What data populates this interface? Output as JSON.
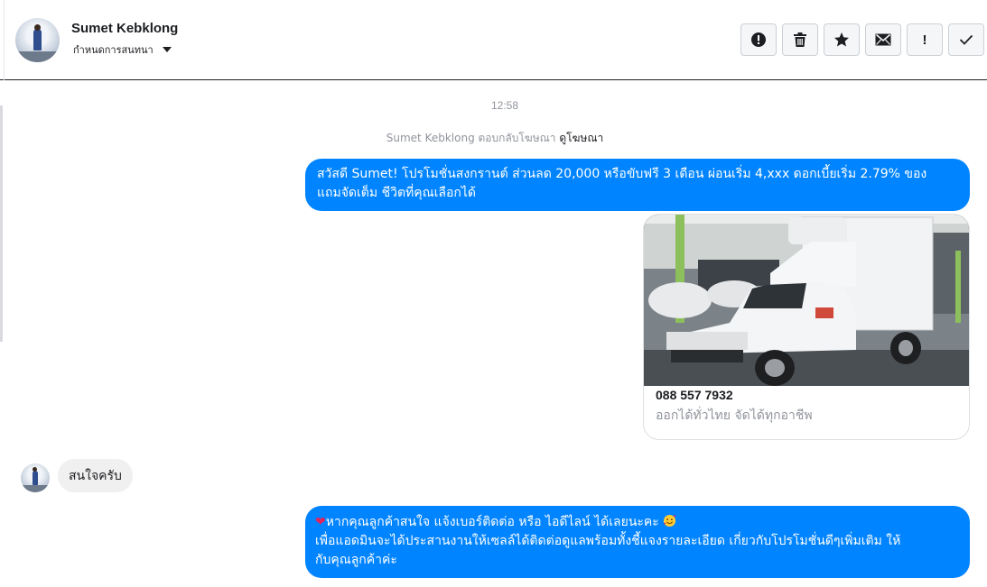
{
  "header": {
    "contact_name": "Sumet Kebklong",
    "subtitle": "กำหนดการสนทนา",
    "actions": [
      {
        "name": "report-button",
        "icon": "alert-circle-icon"
      },
      {
        "name": "delete-button",
        "icon": "trash-icon"
      },
      {
        "name": "star-button",
        "icon": "star-icon"
      },
      {
        "name": "mark-unread-button",
        "icon": "envelope-icon"
      },
      {
        "name": "important-button",
        "icon": "exclamation-icon",
        "label": "!"
      },
      {
        "name": "done-button",
        "icon": "check-icon"
      }
    ]
  },
  "conversation": {
    "timestamp": "12:58",
    "ad_reply": {
      "text": "Sumet Kebklong ตอบกลับโฆษณา",
      "link": "ดูโฆษณา"
    },
    "messages": [
      {
        "direction": "outgoing",
        "text_line1": "สวัสดี Sumet! โปรโมชั่นสงกรานต์ ส่วนลด 20,000 หรือขับฟรี 3 เดือน ผ่อนเริ่ม 4,xxx ดอกเบี้ยเริ่ม 2.79% ของ",
        "text_line2": "แถมจัดเต็ม ชีวิตที่คุณเลือกได้"
      },
      {
        "direction": "outgoing",
        "type": "card",
        "image": "white refrigerated pickup truck",
        "title": "088 557 7932",
        "subtitle": "ออกได้ทั่วไทย จัดได้ทุกอาชีพ"
      },
      {
        "direction": "incoming",
        "text": "สนใจครับ"
      },
      {
        "direction": "outgoing",
        "line1_icon": "heart-icon",
        "line1": "หากคุณลูกค้าสนใจ แจ้งเบอร์ติดต่อ หรือ ไอดีไลน์ ได้เลยนะคะ",
        "line1_emoji": "smiling-face-with-hearts",
        "line2": "เพื่อแอดมินจะได้ประสานงานให้เซลล์ได้ติดต่อดูแลพร้อมทั้งชี้แจงรายละเอียด เกี่ยวกับโปรโมชั่นดีๆเพิ่มเติม ให้",
        "line3": "กับคุณลูกค้าค่ะ"
      }
    ]
  },
  "colors": {
    "outgoing_bubble": "#0084ff",
    "incoming_bubble": "#f1f0f0",
    "muted_text": "#90949c",
    "heart": "#e0245e"
  }
}
